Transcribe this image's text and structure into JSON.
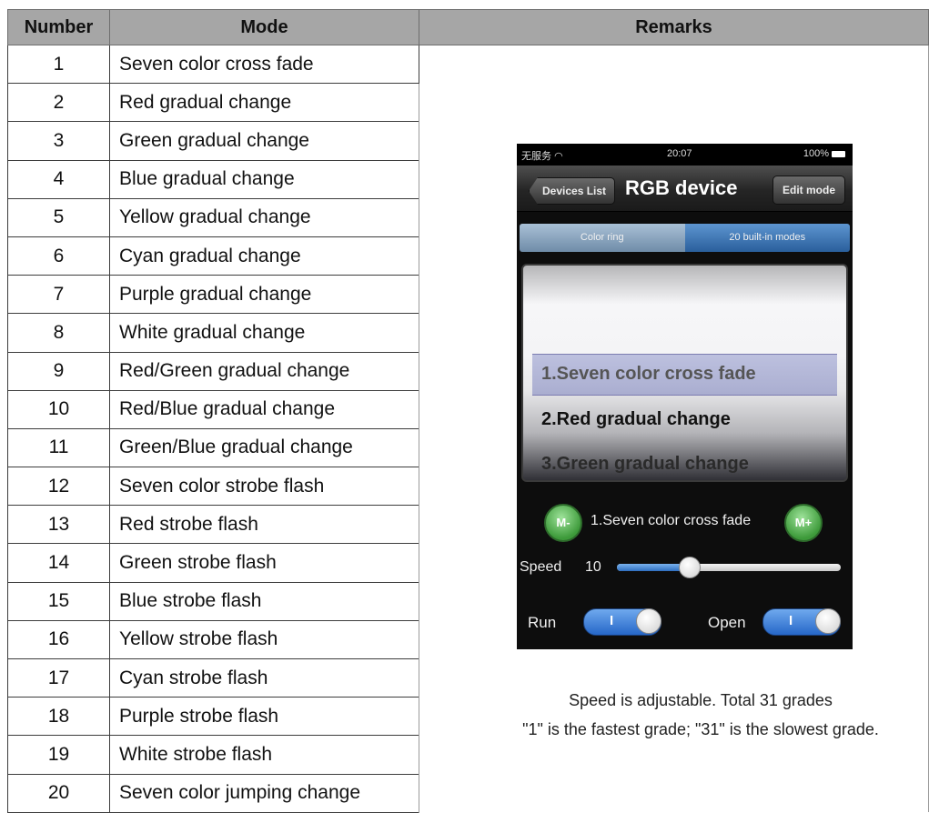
{
  "table": {
    "headers": [
      "Number",
      "Mode",
      "Remarks"
    ],
    "rows": [
      {
        "number": "1",
        "mode": "Seven color cross fade"
      },
      {
        "number": "2",
        "mode": "Red gradual change"
      },
      {
        "number": "3",
        "mode": "Green gradual change"
      },
      {
        "number": "4",
        "mode": "Blue gradual change"
      },
      {
        "number": "5",
        "mode": "Yellow gradual change"
      },
      {
        "number": "6",
        "mode": "Cyan gradual change"
      },
      {
        "number": "7",
        "mode": "Purple gradual change"
      },
      {
        "number": "8",
        "mode": "White gradual change"
      },
      {
        "number": "9",
        "mode": "Red/Green gradual change"
      },
      {
        "number": "10",
        "mode": "Red/Blue gradual change"
      },
      {
        "number": "11",
        "mode": "Green/Blue gradual change"
      },
      {
        "number": "12",
        "mode": "Seven color strobe flash"
      },
      {
        "number": "13",
        "mode": "Red strobe flash"
      },
      {
        "number": "14",
        "mode": "Green strobe flash"
      },
      {
        "number": "15",
        "mode": "Blue strobe flash"
      },
      {
        "number": "16",
        "mode": "Yellow strobe flash"
      },
      {
        "number": "17",
        "mode": "Cyan strobe flash"
      },
      {
        "number": "18",
        "mode": "Purple strobe flash"
      },
      {
        "number": "19",
        "mode": "White strobe flash"
      },
      {
        "number": "20",
        "mode": "Seven color jumping change"
      }
    ]
  },
  "phone": {
    "status": {
      "carrier": "无服务",
      "time": "20:07",
      "battery": "100%"
    },
    "nav": {
      "back_label": "Devices List",
      "title": "RGB device",
      "edit_label": "Edit mode"
    },
    "segments": [
      "Color ring",
      "20 built-in modes"
    ],
    "picker_items": [
      "1.Seven color cross fade",
      "2.Red  gradual change",
      "3.Green gradual change"
    ],
    "m_minus_label": "M-",
    "m_plus_label": "M+",
    "current_mode": "1.Seven color cross fade",
    "speed_label": "Speed",
    "speed_value": "10",
    "speed_fraction": 0.32,
    "run_label": "Run",
    "open_label": "Open",
    "toggle_on_mark": "I",
    "run_on": true,
    "open_on": true
  },
  "captions": {
    "line1": "Speed is adjustable. Total 31 grades",
    "line2": "\"1\" is the fastest grade; \"31\" is the slowest grade."
  }
}
